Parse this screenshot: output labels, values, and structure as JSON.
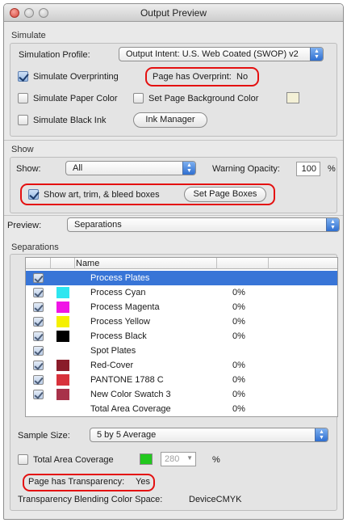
{
  "window": {
    "title": "Output Preview"
  },
  "simulate": {
    "section_label": "Simulate",
    "profile_label": "Simulation Profile:",
    "profile_value": "Output Intent: U.S. Web Coated (SWOP) v2",
    "overprinting_label": "Simulate Overprinting",
    "overprinting_checked": true,
    "page_overprint_label": "Page has Overprint:",
    "page_overprint_value": "No",
    "paper_color_label": "Simulate Paper Color",
    "paper_color_checked": false,
    "page_bg_label": "Set Page Background Color",
    "page_bg_checked": false,
    "black_ink_label": "Simulate Black Ink",
    "black_ink_checked": false,
    "ink_manager_button": "Ink Manager"
  },
  "show": {
    "section_label": "Show",
    "show_label": "Show:",
    "show_value": "All",
    "warning_opacity_label": "Warning Opacity:",
    "warning_opacity_value": "100",
    "warning_opacity_unit": "%",
    "boxes_label": "Show art, trim, & bleed boxes",
    "boxes_checked": true,
    "set_page_boxes_button": "Set Page Boxes"
  },
  "preview": {
    "label": "Preview:",
    "value": "Separations"
  },
  "separations": {
    "section_label": "Separations",
    "column_name": "Name",
    "rows": [
      {
        "name": "Process Plates",
        "color": "",
        "percent": "",
        "checked": true,
        "selected": true
      },
      {
        "name": "Process Cyan",
        "color": "#2ee6f0",
        "percent": "0%",
        "checked": true,
        "selected": false
      },
      {
        "name": "Process Magenta",
        "color": "#f014e6",
        "percent": "0%",
        "checked": true,
        "selected": false
      },
      {
        "name": "Process Yellow",
        "color": "#f5f000",
        "percent": "0%",
        "checked": true,
        "selected": false
      },
      {
        "name": "Process Black",
        "color": "#000000",
        "percent": "0%",
        "checked": true,
        "selected": false
      },
      {
        "name": "Spot Plates",
        "color": "",
        "percent": "",
        "checked": true,
        "selected": false
      },
      {
        "name": "Red-Cover",
        "color": "#8a1c2a",
        "percent": "0%",
        "checked": true,
        "selected": false
      },
      {
        "name": "PANTONE 1788 C",
        "color": "#d8323c",
        "percent": "0%",
        "checked": true,
        "selected": false
      },
      {
        "name": "New Color Swatch 3",
        "color": "#a8324a",
        "percent": "0%",
        "checked": true,
        "selected": false
      },
      {
        "name": "Total Area Coverage",
        "color": "",
        "percent": "0%",
        "checked": false,
        "selected": false
      }
    ]
  },
  "sample": {
    "label": "Sample Size:",
    "value": "5 by 5 Average"
  },
  "coverage": {
    "label": "Total Area Coverage",
    "checked": false,
    "swatch_color": "#22c81e",
    "value": "280",
    "unit": "%"
  },
  "transparency": {
    "label": "Page has Transparency:",
    "value": "Yes",
    "blending_label": "Transparency Blending Color Space:",
    "blending_value": "DeviceCMYK"
  },
  "colors": {
    "highlight": "#e41010",
    "selection": "#3875d7"
  }
}
